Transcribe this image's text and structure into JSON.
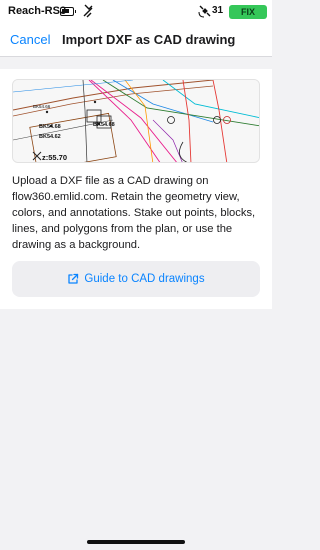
{
  "status_bar": {
    "device_name": "Reach-RS3",
    "satellite_count": "31",
    "fix_status": "FIX",
    "icons": [
      "battery-icon",
      "mute-icon",
      "satellite-icon"
    ],
    "fix_color": "#35c759"
  },
  "nav": {
    "cancel_label": "Cancel",
    "title": "Import DXF as CAD drawing"
  },
  "preview": {
    "labels": {
      "bk1": "BK54.68",
      "bk2": "BK54.66",
      "bk3": "BK54.62",
      "bk4": "BK54.68",
      "z": "z:55.70"
    }
  },
  "description": "Upload a DXF file as a CAD drawing on flow360.emlid.com. Retain the geometry view, colors, and annotations. Stake out points, blocks, lines, and polygons from the plan, or use the drawing as a background.",
  "guide_button": {
    "label": "Guide to CAD drawings",
    "icon": "external-link-icon"
  },
  "colors": {
    "accent": "#0a84ff",
    "background": "#f2f2f4",
    "button_bg": "#eeeef1"
  }
}
